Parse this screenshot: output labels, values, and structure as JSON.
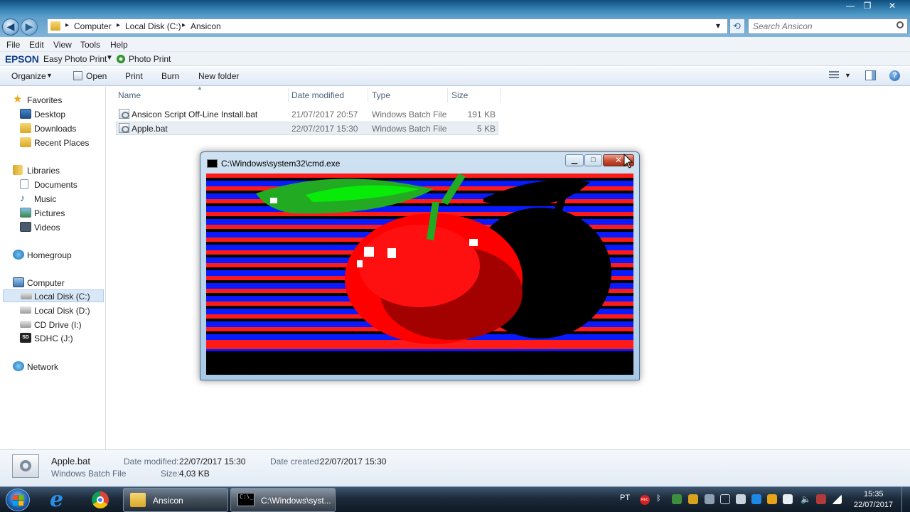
{
  "window": {
    "minimize": "—",
    "maximize": "❐",
    "close": "✕"
  },
  "address": {
    "back": "◀",
    "forward": "▶",
    "crumbs": [
      "Computer",
      "Local Disk (C:)",
      "Ansicon"
    ],
    "dropdown": "▾",
    "refresh": "⟲",
    "search_placeholder": "Search Ansicon"
  },
  "menu": [
    "File",
    "Edit",
    "View",
    "Tools",
    "Help"
  ],
  "epson": {
    "brand": "EPSON",
    "app": "Easy Photo Print",
    "photo_print": "Photo Print"
  },
  "toolbar": {
    "organize": "Organize",
    "open": "Open",
    "print": "Print",
    "burn": "Burn",
    "new_folder": "New folder"
  },
  "nav": {
    "favorites": "Favorites",
    "desktop": "Desktop",
    "downloads": "Downloads",
    "recent": "Recent Places",
    "libraries": "Libraries",
    "documents": "Documents",
    "music": "Music",
    "pictures": "Pictures",
    "videos": "Videos",
    "homegroup": "Homegroup",
    "computer": "Computer",
    "local_c": "Local Disk (C:)",
    "local_d": "Local Disk (D:)",
    "cd_drive": "CD Drive (I:)",
    "sdhc": "SDHC (J:)",
    "network": "Network"
  },
  "columns": {
    "name": "Name",
    "date": "Date modified",
    "type": "Type",
    "size": "Size"
  },
  "files": [
    {
      "name": "Ansicon Script Off-Line Install.bat",
      "date": "21/07/2017 20:57",
      "type": "Windows Batch File",
      "size": "191 KB"
    },
    {
      "name": "Apple.bat",
      "date": "22/07/2017 15:30",
      "type": "Windows Batch File",
      "size": "5 KB"
    }
  ],
  "details": {
    "name": "Apple.bat",
    "kind": "Windows Batch File",
    "modified_label": "Date modified:",
    "modified": "22/07/2017 15:30",
    "size_label": "Size:",
    "size": "4,03 KB",
    "created_label": "Date created:",
    "created": "22/07/2017 15:30"
  },
  "cmd": {
    "title": "C:\\Windows\\system32\\cmd.exe",
    "min": "▁",
    "max": "□",
    "close": "✕"
  },
  "taskbar": {
    "task_explorer": "Ansicon",
    "task_cmd": "C:\\Windows\\syst...",
    "lang": "PT",
    "rec": "REC",
    "time": "15:35",
    "date": "22/07/2017"
  },
  "colors": {
    "stripe_red": "#ff1a1a",
    "stripe_blue": "#0a1aff",
    "apple_red": "#ff0000",
    "apple_dark": "#a30000",
    "leaf_green": "#22aa22",
    "leaf_light": "#00ff00"
  }
}
